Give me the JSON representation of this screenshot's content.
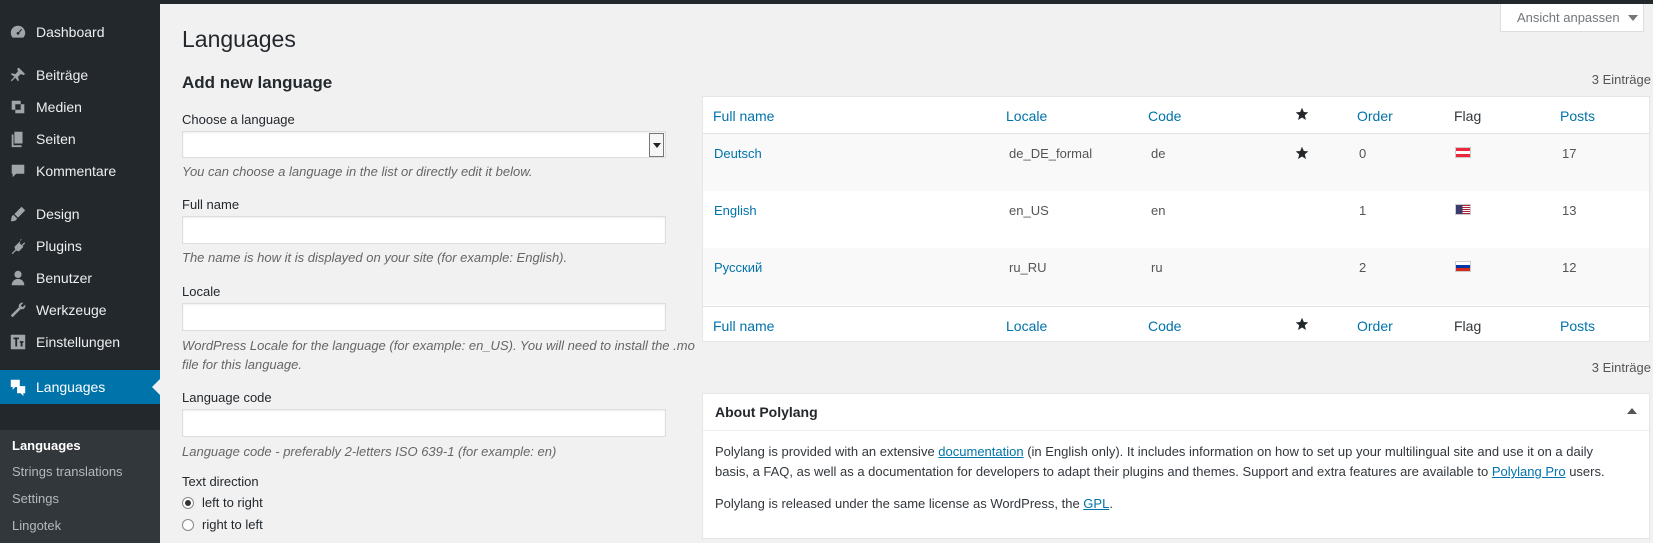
{
  "sidebar": {
    "items": [
      {
        "label": "Dashboard",
        "icon": "dashboard-icon"
      },
      {
        "label": "Beiträge",
        "icon": "pushpin-icon"
      },
      {
        "label": "Medien",
        "icon": "media-icon"
      },
      {
        "label": "Seiten",
        "icon": "pages-icon"
      },
      {
        "label": "Kommentare",
        "icon": "comment-icon"
      },
      {
        "label": "Design",
        "icon": "brush-icon"
      },
      {
        "label": "Plugins",
        "icon": "plugin-icon"
      },
      {
        "label": "Benutzer",
        "icon": "user-icon"
      },
      {
        "label": "Werkzeuge",
        "icon": "wrench-icon"
      },
      {
        "label": "Einstellungen",
        "icon": "settings-icon"
      },
      {
        "label": "Languages",
        "icon": "translate-icon"
      }
    ],
    "submenu": [
      "Languages",
      "Strings translations",
      "Settings",
      "Lingotek"
    ]
  },
  "screen_options": "Ansicht anpassen",
  "page_title": "Languages",
  "form": {
    "title": "Add new language",
    "choose_label": "Choose a language",
    "choose_hint": "You can choose a language in the list or directly edit it below.",
    "fullname_label": "Full name",
    "fullname_hint": "The name is how it is displayed on your site (for example: English).",
    "locale_label": "Locale",
    "locale_hint_1": "WordPress Locale for the language (for example: en_US). You will need to install the .mo",
    "locale_hint_2": "file for this language.",
    "code_label": "Language code",
    "code_hint": "Language code - preferably 2-letters ISO 639-1 (for example: en)",
    "direction_label": "Text direction",
    "direction_ltr": "left to right",
    "direction_rtl": "right to left"
  },
  "table": {
    "count": "3 Einträge",
    "headers": {
      "fullname": "Full name",
      "locale": "Locale",
      "code": "Code",
      "order": "Order",
      "flag": "Flag",
      "posts": "Posts"
    },
    "rows": [
      {
        "name": "Deutsch",
        "locale": "de_DE_formal",
        "code": "de",
        "order": "0",
        "posts": "17",
        "default": true
      },
      {
        "name": "English",
        "locale": "en_US",
        "code": "en",
        "order": "1",
        "posts": "13",
        "default": false
      },
      {
        "name": "Русский",
        "locale": "ru_RU",
        "code": "ru",
        "order": "2",
        "posts": "12",
        "default": false
      }
    ]
  },
  "about": {
    "title": "About Polylang",
    "p1_a": "Polylang is provided with an extensive ",
    "p1_link1": "documentation",
    "p1_b": " (in English only). It includes information on how to set up your multilingual site and use it on a daily",
    "p1_c": "basis, a FAQ, as well as a documentation for developers to adapt their plugins and themes. Support and extra features are available to ",
    "p1_link2": "Polylang Pro",
    "p1_d": " users.",
    "p2_a": "Polylang is released under the same license as WordPress, the ",
    "p2_link": "GPL",
    "p2_b": "."
  },
  "colors": {
    "sidebar": "#23282d",
    "accent": "#0073aa",
    "link": "#0073aa"
  }
}
